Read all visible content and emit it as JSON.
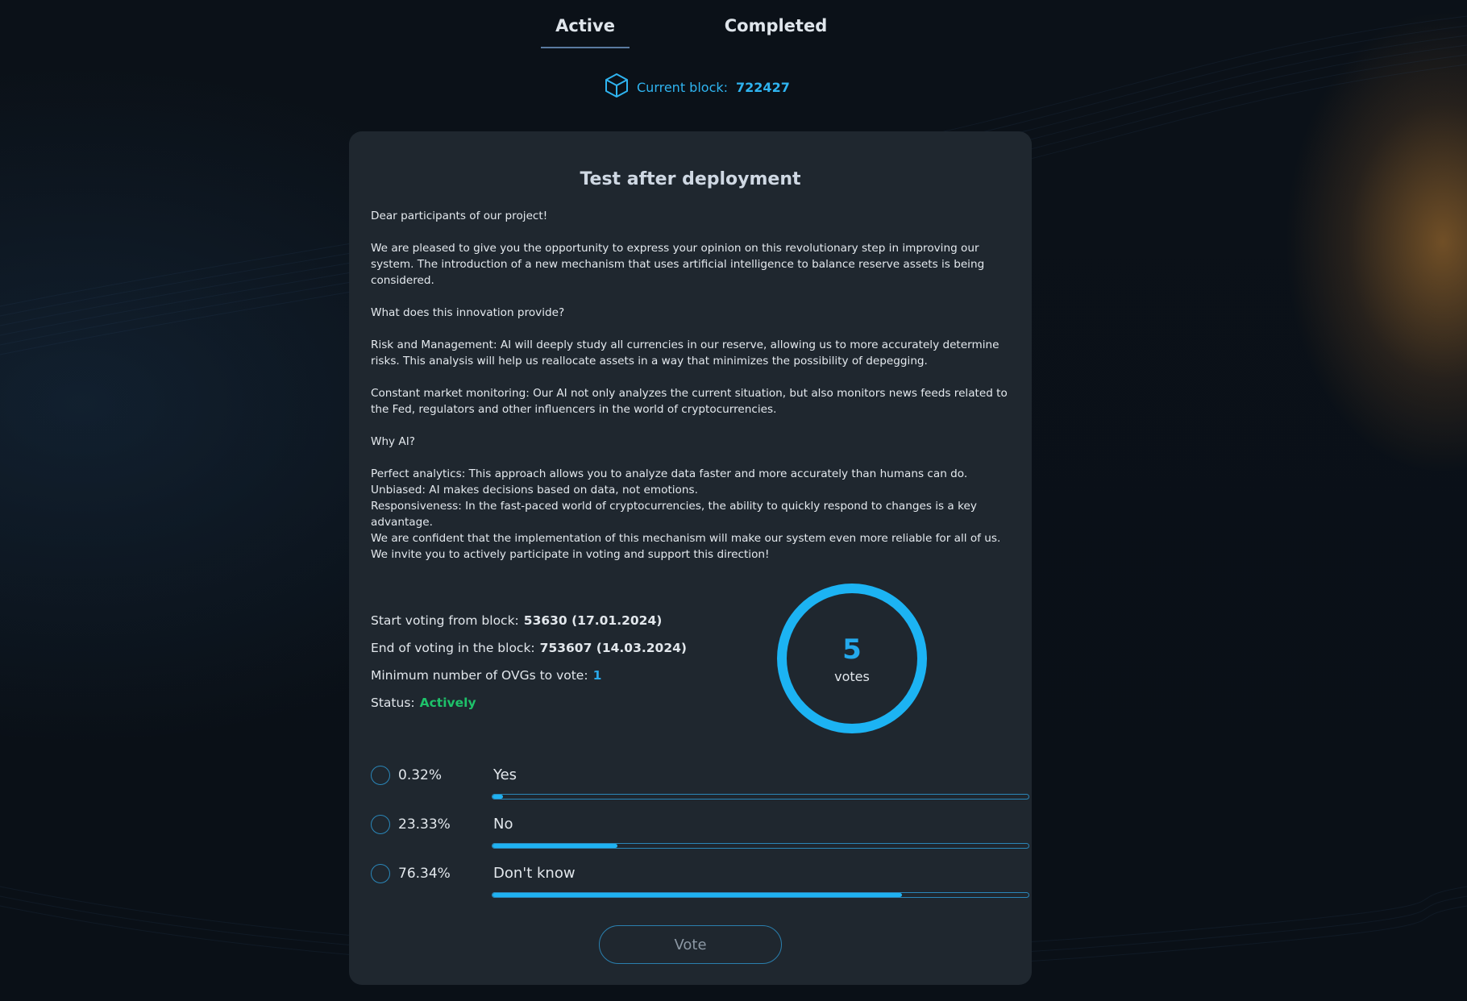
{
  "tabs": [
    {
      "label": "Active",
      "active": true
    },
    {
      "label": "Completed",
      "active": false
    }
  ],
  "current_block": {
    "label": "Current block:",
    "value": "722427"
  },
  "proposal": {
    "title": "Test after deployment",
    "paragraphs": [
      [
        "Dear participants of our project!"
      ],
      [
        "We are pleased to give you the opportunity to express your opinion on this revolutionary step in improving our system. The introduction of a new mechanism that uses artificial intelligence to balance reserve assets is being considered."
      ],
      [
        "What does this innovation provide?"
      ],
      [
        "Risk and Management: AI will deeply study all currencies in our reserve, allowing us to more accurately determine risks. This analysis will help us reallocate assets in a way that minimizes the possibility of depegging."
      ],
      [
        "Constant market monitoring: Our AI not only analyzes the current situation, but also monitors news feeds related to the Fed, regulators and other influencers in the world of cryptocurrencies."
      ],
      [
        "Why AI?"
      ],
      [
        "Perfect analytics: This approach allows you to analyze data faster and more accurately than humans can do.",
        "Unbiased: AI makes decisions based on data, not emotions.",
        "Responsiveness: In the fast-paced world of cryptocurrencies, the ability to quickly respond to changes is a key advantage.",
        "We are confident that the implementation of this mechanism will make our system even more reliable for all of us. We invite you to actively participate in voting and support this direction!"
      ]
    ]
  },
  "info": {
    "start_label": "Start voting from block:",
    "start_value": "53630 (17.01.2024)",
    "end_label": "End of voting in the block:",
    "end_value": "753607 (14.03.2024)",
    "min_label": "Minimum number of OVGs to vote:",
    "min_value": "1",
    "status_label": "Status:",
    "status_value": "Actively"
  },
  "votes": {
    "count": "5",
    "label": "votes"
  },
  "options": [
    {
      "percent_label": "0.32%",
      "label": "Yes",
      "fraction": 0.0032
    },
    {
      "percent_label": "23.33%",
      "label": "No",
      "fraction": 0.2333
    },
    {
      "percent_label": "76.34%",
      "label": "Don't know",
      "fraction": 0.7634
    }
  ],
  "vote_button": "Vote",
  "colors": {
    "accent": "#1fb2f2",
    "status_green": "#1ec26a",
    "card_bg": "#1f272f",
    "bg": "#0a1017"
  }
}
